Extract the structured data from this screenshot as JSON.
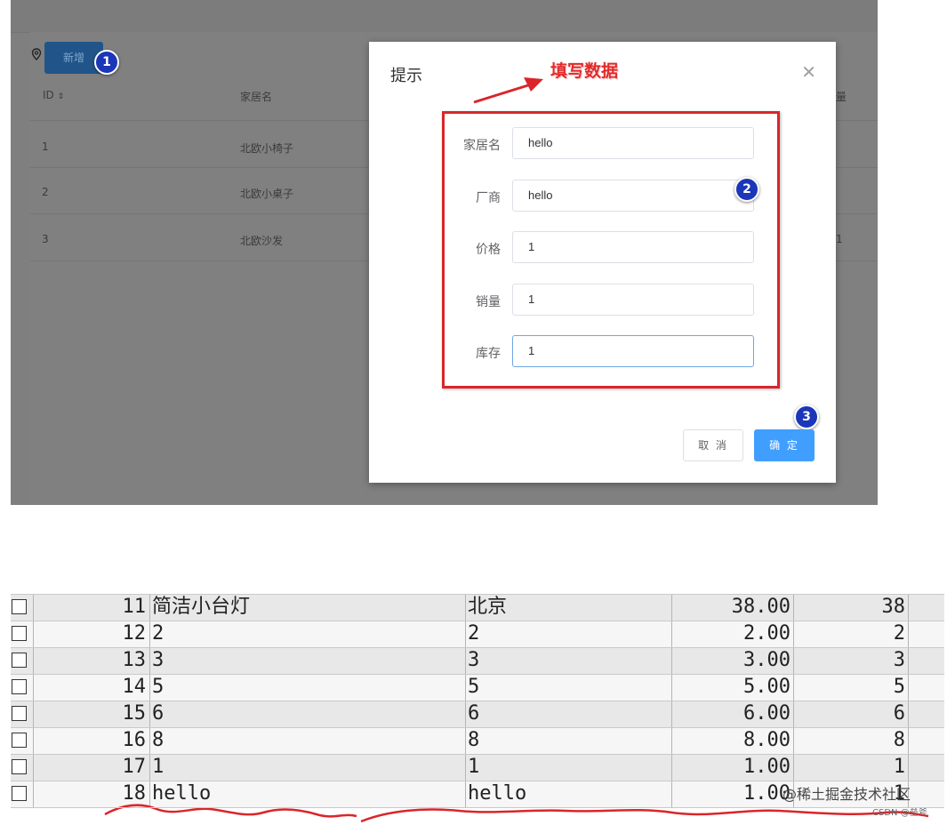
{
  "app": {
    "add_button": "新增",
    "table": {
      "headers": [
        "ID",
        "家居名"
      ],
      "rows": [
        {
          "id": "1",
          "name": "北欧小椅子"
        },
        {
          "id": "2",
          "name": "北欧小桌子"
        },
        {
          "id": "3",
          "name": "北欧沙发"
        }
      ],
      "partial_header_right": "量",
      "partial_cells_right": [
        "",
        "",
        "1"
      ]
    }
  },
  "modal": {
    "title": "提示",
    "annotation": "填写数据",
    "fields": [
      {
        "label": "家居名",
        "value": "hello"
      },
      {
        "label": "厂商",
        "value": "hello"
      },
      {
        "label": "价格",
        "value": "1"
      },
      {
        "label": "销量",
        "value": "1"
      },
      {
        "label": "库存",
        "value": "1"
      }
    ],
    "cancel_label": "取 消",
    "ok_label": "确 定"
  },
  "steps": [
    "1",
    "2",
    "3"
  ],
  "grid": {
    "rows": [
      {
        "id": "11",
        "name": "简洁小台灯",
        "maker": "北京",
        "price": "38.00",
        "sales": "38"
      },
      {
        "id": "12",
        "name": "2",
        "maker": "2",
        "price": "2.00",
        "sales": "2"
      },
      {
        "id": "13",
        "name": "3",
        "maker": "3",
        "price": "3.00",
        "sales": "3"
      },
      {
        "id": "14",
        "name": "5",
        "maker": "5",
        "price": "5.00",
        "sales": "5"
      },
      {
        "id": "15",
        "name": "6",
        "maker": "6",
        "price": "6.00",
        "sales": "6"
      },
      {
        "id": "16",
        "name": "8",
        "maker": "8",
        "price": "8.00",
        "sales": "8"
      },
      {
        "id": "17",
        "name": "1",
        "maker": "1",
        "price": "1.00",
        "sales": "1"
      },
      {
        "id": "18",
        "name": "hello",
        "maker": "hello",
        "price": "1.00",
        "sales": "1"
      }
    ]
  },
  "watermark": {
    "main": "@稀土掘金技术社区",
    "sub": "CSDN @垒斧"
  },
  "colors": {
    "overlay": "#7f7f7f",
    "primary": "#409eff",
    "annotation_red": "#d9262a",
    "badge_blue": "#1b36b8"
  }
}
